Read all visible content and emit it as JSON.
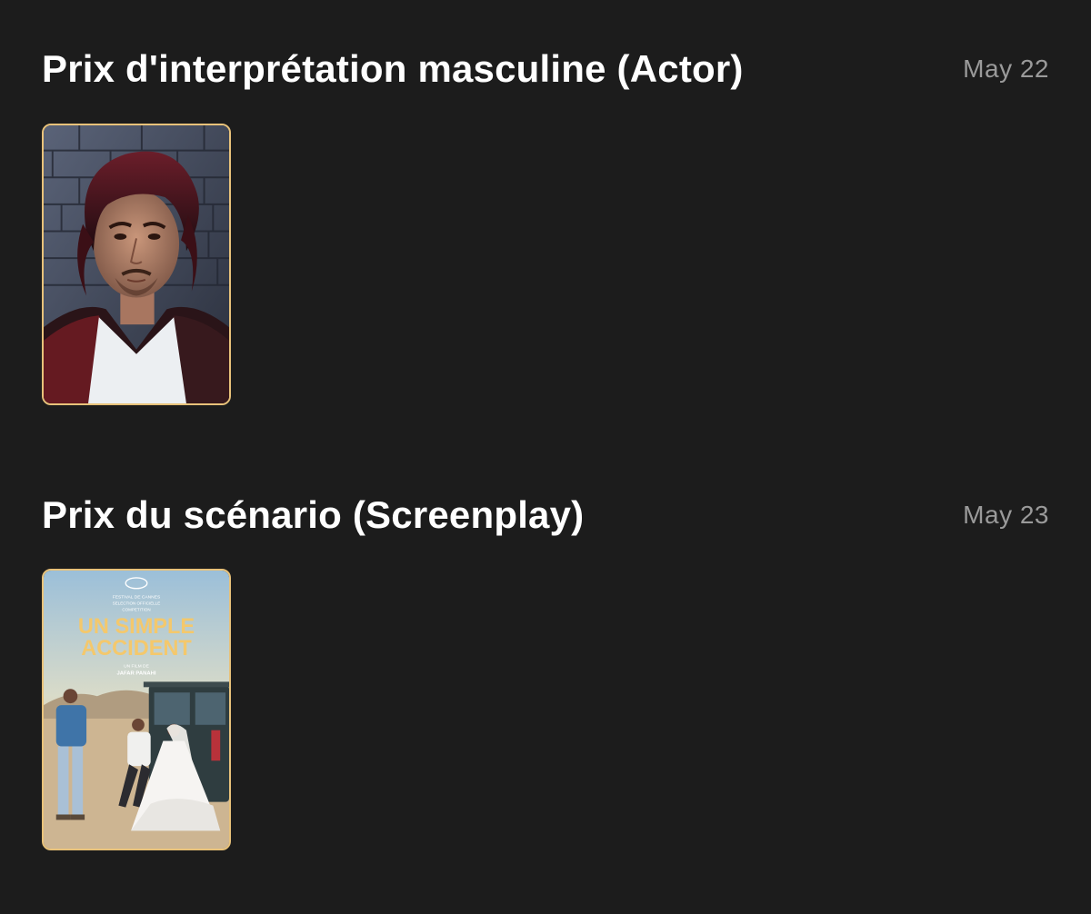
{
  "theme": {
    "background": "#1c1c1c",
    "accent_border": "#e8c27a",
    "date_color": "#9a9a9a"
  },
  "sections": [
    {
      "title": "Prix d'interprétation masculine (Actor)",
      "date": "May 22",
      "poster_icon": "actor-portrait"
    },
    {
      "title": "Prix du scénario (Screenplay)",
      "date": "May 23",
      "poster_icon": "film-poster",
      "poster_text": {
        "festival_line1": "FESTIVAL DE CANNES",
        "festival_line2": "SELECTION OFFICIELLE",
        "festival_line3": "COMPETITION",
        "title_line1": "UN SIMPLE",
        "title_line2": "ACCIDENT",
        "byline1": "UN FILM DE",
        "byline2": "JAFAR PANAHI"
      }
    }
  ]
}
